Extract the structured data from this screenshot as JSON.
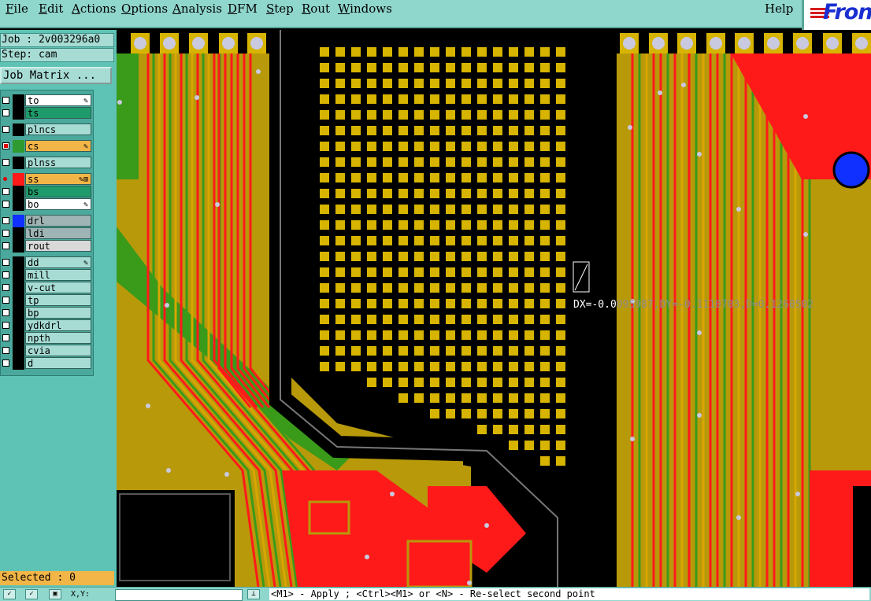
{
  "menu": {
    "items": [
      {
        "label": "File",
        "ul": "F"
      },
      {
        "label": "Edit",
        "ul": "E"
      },
      {
        "label": "Actions",
        "ul": "A"
      },
      {
        "label": "Options",
        "ul": "O"
      },
      {
        "label": "Analysis",
        "ul": "A"
      },
      {
        "label": "DFM",
        "ul": "D"
      },
      {
        "label": "Step",
        "ul": "S"
      },
      {
        "label": "Rout",
        "ul": "R"
      },
      {
        "label": "Windows",
        "ul": "W"
      }
    ],
    "help": "Help",
    "logo": "Fron"
  },
  "job": {
    "job_line": "Job : 2v003296a0",
    "step_line": "Step: cam",
    "matrix_button": "Job Matrix ..."
  },
  "layers": [
    {
      "name": "to",
      "bg": "#ffffff",
      "color": "#000000",
      "flag": "✎"
    },
    {
      "name": "ts",
      "bg": "#1f9a6a",
      "color": "#000000",
      "flag": ""
    },
    {
      "name": "plncs",
      "bg": "#a6dcd4",
      "color": "#000000",
      "flag": ""
    },
    {
      "name": "cs",
      "bg": "#f2b547",
      "color": "#2f9a2f",
      "flag": "✎",
      "checked": true
    },
    {
      "name": "plnss",
      "bg": "#a6dcd4",
      "color": "#000000",
      "flag": ""
    },
    {
      "name": "ss",
      "bg": "#f2b547",
      "color": "#ff1a1a",
      "flag": "✎⊞",
      "dot": true
    },
    {
      "name": "bs",
      "bg": "#1f9a6a",
      "color": "#000000",
      "flag": ""
    },
    {
      "name": "bo",
      "bg": "#ffffff",
      "color": "#000000",
      "flag": "✎"
    },
    {
      "name": "drl",
      "bg": "#9fb4b4",
      "color": "#1030ff",
      "flag": ""
    },
    {
      "name": "ldi",
      "bg": "#9fb4b4",
      "color": "#000000",
      "flag": ""
    },
    {
      "name": "rout",
      "bg": "#d9d9d9",
      "color": "#000000",
      "flag": ""
    },
    {
      "name": "dd",
      "bg": "#a6dcd4",
      "color": "#000000",
      "flag": "✎"
    },
    {
      "name": "mill",
      "bg": "#a6dcd4",
      "color": "#000000",
      "flag": ""
    },
    {
      "name": "v-cut",
      "bg": "#a6dcd4",
      "color": "#000000",
      "flag": ""
    },
    {
      "name": "tp",
      "bg": "#a6dcd4",
      "color": "#000000",
      "flag": ""
    },
    {
      "name": "bp",
      "bg": "#a6dcd4",
      "color": "#000000",
      "flag": ""
    },
    {
      "name": "ydkdrl",
      "bg": "#a6dcd4",
      "color": "#000000",
      "flag": ""
    },
    {
      "name": "npth",
      "bg": "#a6dcd4",
      "color": "#000000",
      "flag": ""
    },
    {
      "name": "cvia",
      "bg": "#a6dcd4",
      "color": "#000000",
      "flag": ""
    },
    {
      "name": "d",
      "bg": "#a6dcd4",
      "color": "#000000",
      "flag": ""
    }
  ],
  "selected": "Selected : 0",
  "measure": {
    "prefix": "DX=-0.0",
    "rest": "095987,DY=-0.1110703,D=0.1260502"
  },
  "status": {
    "coord_label": "X,Y:",
    "message": "<M1> - Apply  ; <Ctrl><M1> or <N> - Re-select second point"
  },
  "colors": {
    "copper": "#b8990a",
    "trace_red": "#ff1a1a",
    "trace_green": "#3a9a1a",
    "pad": "#d6b400",
    "via": "#c9c9e0",
    "drill": "#1030ff"
  }
}
